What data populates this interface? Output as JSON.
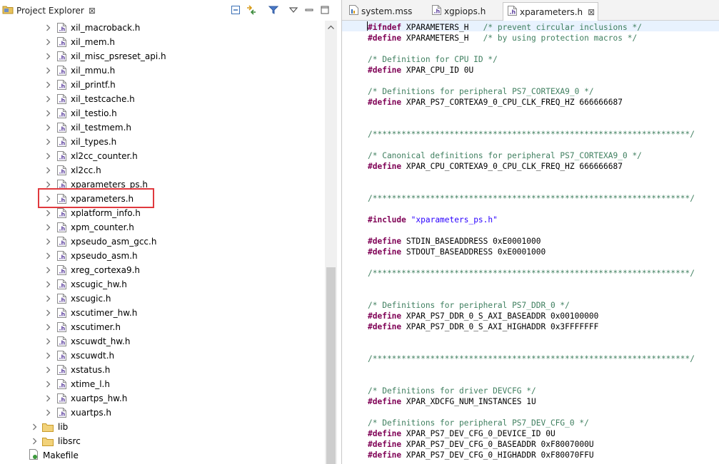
{
  "project_explorer": {
    "title": "Project Explorer",
    "close_glyph": "⊠",
    "toolbar": [
      "collapse-all-icon",
      "link-with-editor-icon",
      "filter-icon",
      "view-menu-icon",
      "minimize-icon",
      "maximize-icon"
    ],
    "files": [
      "xil_macroback.h",
      "xil_mem.h",
      "xil_misc_psreset_api.h",
      "xil_mmu.h",
      "xil_printf.h",
      "xil_testcache.h",
      "xil_testio.h",
      "xil_testmem.h",
      "xil_types.h",
      "xl2cc_counter.h",
      "xl2cc.h",
      "xparameters_ps.h",
      "xparameters.h",
      "xplatform_info.h",
      "xpm_counter.h",
      "xpseudo_asm_gcc.h",
      "xpseudo_asm.h",
      "xreg_cortexa9.h",
      "xscugic_hw.h",
      "xscugic.h",
      "xscutimer_hw.h",
      "xscutimer.h",
      "xscuwdt_hw.h",
      "xscuwdt.h",
      "xstatus.h",
      "xtime_l.h",
      "xuartps_hw.h",
      "xuartps.h"
    ],
    "folders": [
      "lib",
      "libsrc"
    ],
    "makefile": "Makefile",
    "selected": "xparameters.h"
  },
  "editor": {
    "tabs": [
      {
        "label": "system.mss",
        "icon": "mss-file-icon"
      },
      {
        "label": "xgpiops.h",
        "icon": "header-file-icon"
      },
      {
        "label": "xparameters.h",
        "icon": "header-file-icon",
        "active": true
      }
    ],
    "close_glyph": "⊠",
    "lines": [
      "#ifndef XPARAMETERS_H   /* prevent circular inclusions */",
      "#define XPARAMETERS_H   /* by using protection macros */",
      "",
      "/* Definition for CPU ID */",
      "#define XPAR_CPU_ID 0U",
      "",
      "/* Definitions for peripheral PS7_CORTEXA9_0 */",
      "#define XPAR_PS7_CORTEXA9_0_CPU_CLK_FREQ_HZ 666666687",
      "",
      "",
      "/******************************************************************/",
      "",
      "/* Canonical definitions for peripheral PS7_CORTEXA9_0 */",
      "#define XPAR_CPU_CORTEXA9_0_CPU_CLK_FREQ_HZ 666666687",
      "",
      "",
      "/******************************************************************/",
      "",
      "#include \"xparameters_ps.h\"",
      "",
      "#define STDIN_BASEADDRESS 0xE0001000",
      "#define STDOUT_BASEADDRESS 0xE0001000",
      "",
      "/******************************************************************/",
      "",
      "",
      "/* Definitions for peripheral PS7_DDR_0 */",
      "#define XPAR_PS7_DDR_0_S_AXI_BASEADDR 0x00100000",
      "#define XPAR_PS7_DDR_0_S_AXI_HIGHADDR 0x3FFFFFFF",
      "",
      "",
      "/******************************************************************/",
      "",
      "",
      "/* Definitions for driver DEVCFG */",
      "#define XPAR_XDCFG_NUM_INSTANCES 1U",
      "",
      "/* Definitions for peripheral PS7_DEV_CFG_0 */",
      "#define XPAR_PS7_DEV_CFG_0_DEVICE_ID 0U",
      "#define XPAR_PS7_DEV_CFG_0_BASEADDR 0xF8007000U",
      "#define XPAR_PS7_DEV_CFG_0_HIGHADDR 0xF80070FFU"
    ]
  },
  "colors": {
    "keyword": "#7f0055",
    "comment": "#3f7f5f",
    "string": "#2a00ff",
    "highlight_box": "#e0393e"
  }
}
